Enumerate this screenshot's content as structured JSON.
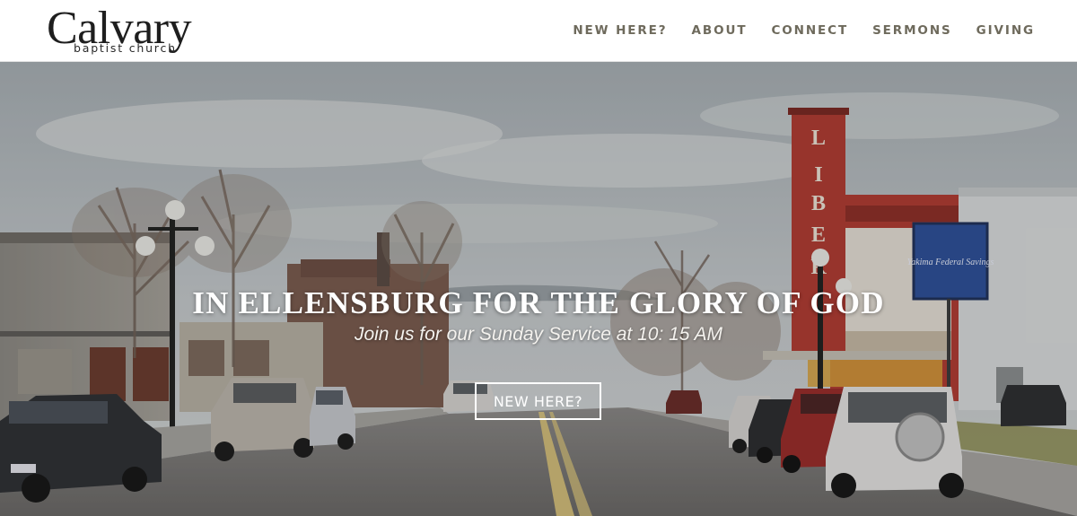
{
  "header": {
    "logo": {
      "name": "Calvary",
      "subtitle": "baptist church"
    },
    "nav": [
      {
        "label": "NEW HERE?"
      },
      {
        "label": "ABOUT"
      },
      {
        "label": "CONNECT"
      },
      {
        "label": "SERMONS"
      },
      {
        "label": "GIVING"
      }
    ]
  },
  "hero": {
    "title": "IN ELLENSBURG FOR THE GLORY OF GOD",
    "subtitle": "Join us for our Sunday Service at 10: 15 AM",
    "button_label": "NEW HERE?",
    "theater_sign_letters": [
      "L",
      "I",
      "B",
      "E",
      "R"
    ],
    "billboard_text": "Yakima Federal Savings"
  },
  "colors": {
    "nav_text": "#6e6a5c",
    "logo_text": "#1e1e1e",
    "theater_red": "#b23a30",
    "billboard_blue": "#2b4f9a"
  }
}
